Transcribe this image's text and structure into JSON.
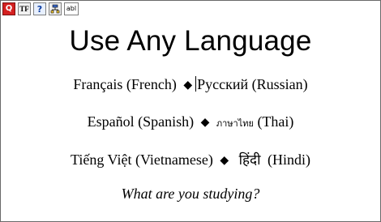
{
  "toolbar": {
    "buttons": [
      {
        "icon": "red-q-icon",
        "label": "Q"
      },
      {
        "icon": "text-format-icon",
        "label": "TF"
      },
      {
        "icon": "help-icon",
        "label": "?"
      },
      {
        "icon": "properties-icon",
        "label": ""
      },
      {
        "icon": "text-field-icon",
        "label": "abl"
      }
    ]
  },
  "content": {
    "title": "Use Any Language",
    "line1": {
      "left": "Français (French)",
      "sep": "◆",
      "right": "Русский (Russian)"
    },
    "line2": {
      "left": "Español (Spanish)",
      "sep": "◆",
      "native": "ภาษาไทย",
      "right": "(Thai)"
    },
    "line3": {
      "left": "Tiếng Việt (Vietnamese)",
      "sep": "◆",
      "native": "हिंदी",
      "right": "(Hindi)"
    },
    "question": "What are you studying?"
  },
  "colors": {
    "background": "#ffffff",
    "text": "#000000",
    "accent": "#d42020",
    "border": "#6a6a6a"
  }
}
